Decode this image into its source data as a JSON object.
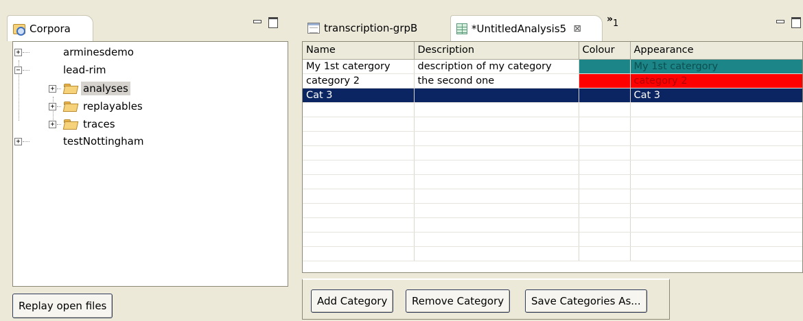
{
  "left_panel": {
    "tab_label": "Corpora",
    "tree": [
      {
        "label": "arminesdemo",
        "expander": "+"
      },
      {
        "label": "lead-rim",
        "expander": "−"
      },
      {
        "label": "analyses",
        "expander": "+",
        "icon": "folder-icon"
      },
      {
        "label": "replayables",
        "expander": "+",
        "icon": "folder-icon"
      },
      {
        "label": "traces",
        "expander": "+",
        "icon": "folder-icon"
      },
      {
        "label": "testNottingham",
        "expander": "+"
      }
    ],
    "replay_button": "Replay open files"
  },
  "right_panel": {
    "tabs": [
      {
        "label": "transcription-grpB",
        "icon": "document-icon"
      },
      {
        "label": "*UntitledAnalysis5",
        "icon": "grid-icon",
        "close": "⊠"
      }
    ],
    "overflow_chevron": "»",
    "overflow_count": "1",
    "table": {
      "columns": [
        "Name",
        "Description",
        "Colour",
        "Appearance"
      ],
      "rows": [
        {
          "name": "My 1st catergory",
          "description": "description of my category",
          "colour": "#1b8587",
          "appearance": "My 1st catergory"
        },
        {
          "name": "category 2",
          "description": "the second one",
          "colour": "#ff0000",
          "appearance": "category 2"
        },
        {
          "name": "Cat 3",
          "description": "",
          "colour": "",
          "appearance": "Cat 3"
        }
      ]
    },
    "buttons": {
      "add": "Add Category",
      "remove": "Remove Category",
      "save": "Save Categories As..."
    }
  },
  "colors": {
    "selection": "#0b2462",
    "background": "#ece9d8"
  }
}
